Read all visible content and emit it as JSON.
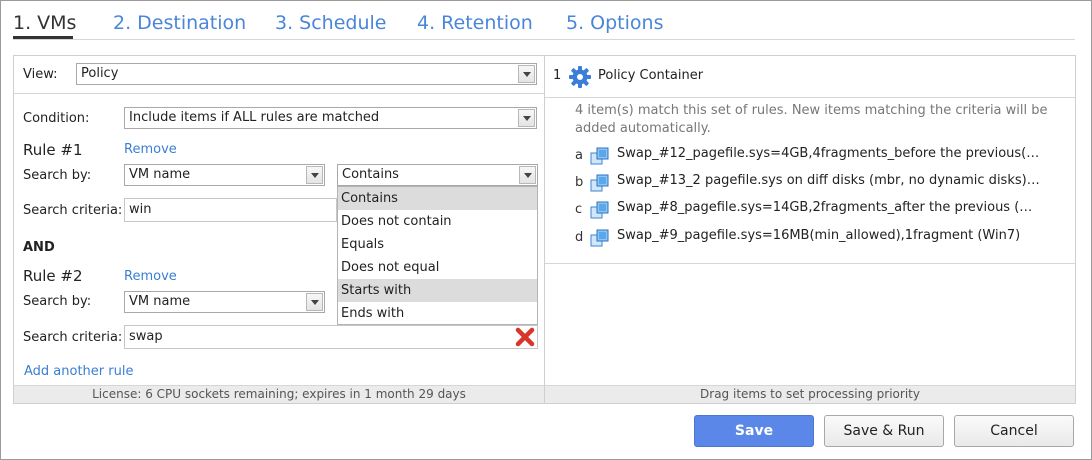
{
  "tabs": [
    {
      "label": "1. VMs"
    },
    {
      "label": "2. Destination"
    },
    {
      "label": "3. Schedule"
    },
    {
      "label": "4. Retention"
    },
    {
      "label": "5. Options"
    }
  ],
  "left": {
    "view_label": "View:",
    "view_value": "Policy",
    "condition_label": "Condition:",
    "condition_value": "Include items if ALL rules are matched",
    "rule1": {
      "title": "Rule #1",
      "remove": "Remove",
      "search_by_label": "Search by:",
      "search_by_value": "VM name",
      "operator_value": "Contains",
      "criteria_label": "Search criteria:",
      "criteria_value": "win"
    },
    "and_label": "AND",
    "rule2": {
      "title": "Rule #2",
      "remove": "Remove",
      "search_by_label": "Search by:",
      "search_by_value": "VM name",
      "criteria_label": "Search criteria:",
      "criteria_value": "swap"
    },
    "add_rule": "Add another rule",
    "operator_options": [
      "Contains",
      "Does not contain",
      "Equals",
      "Does not equal",
      "Starts with",
      "Ends with"
    ],
    "license": "License: 6 CPU sockets remaining; expires in 1 month 29 days"
  },
  "right": {
    "number": "1",
    "title": "Policy Container",
    "info": "4 item(s) match this set of rules. New items matching the criteria will be added automatically.",
    "items": [
      {
        "letter": "a",
        "name": "Swap_#12_pagefile.sys=4GB,4fragments_before the previous(…"
      },
      {
        "letter": "b",
        "name": "Swap_#13_2 pagefile.sys on diff disks (mbr, no dynamic disks)…"
      },
      {
        "letter": "c",
        "name": "Swap_#8_pagefile.sys=14GB,2fragments_after the previous (…"
      },
      {
        "letter": "d",
        "name": "Swap_#9_pagefile.sys=16MB(min_allowed),1fragment (Win7)"
      }
    ],
    "footer": "Drag items to set processing priority"
  },
  "buttons": {
    "save": "Save",
    "save_run": "Save & Run",
    "cancel": "Cancel"
  },
  "colors": {
    "accent": "#4a86d8",
    "save_button": "#5b88e8",
    "remove_icon": "#d9362b"
  }
}
